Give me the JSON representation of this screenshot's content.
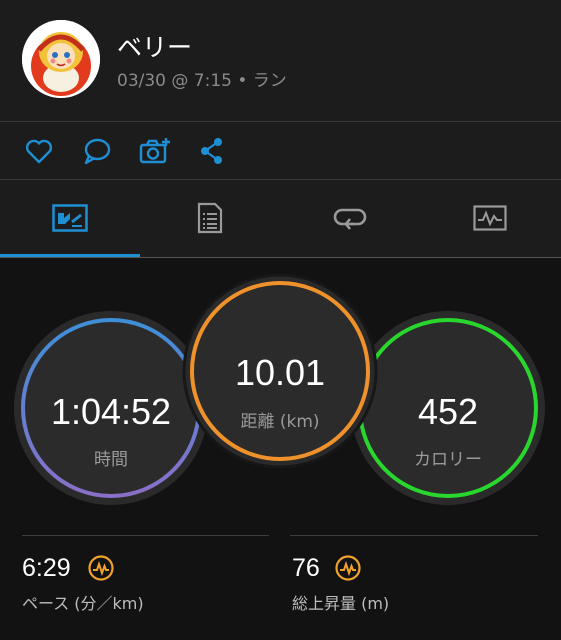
{
  "header": {
    "username": "ベリー",
    "subtitle": "03/30 @ 7:15 • ラン"
  },
  "actions": {
    "icons": [
      "heart-icon",
      "comment-icon",
      "add-photo-icon",
      "share-icon"
    ]
  },
  "tabs": {
    "icons": [
      "overview-icon",
      "details-icon",
      "laps-icon",
      "charts-icon"
    ],
    "active_index": 0
  },
  "metrics": {
    "time": {
      "value": "1:04:52",
      "label": "時間"
    },
    "distance": {
      "value": "10.01",
      "label": "距離 (km)"
    },
    "calories": {
      "value": "452",
      "label": "カロリー"
    }
  },
  "stats": {
    "pace": {
      "value": "6:29",
      "label": "ペース (分／km)",
      "icon": "pace-badge-icon"
    },
    "ascent": {
      "value": "76",
      "label": "総上昇量 (m)",
      "icon": "ascent-badge-icon"
    }
  },
  "colors": {
    "accent_blue": "#1f8fd4",
    "time_ring_top": "#3e8fd8",
    "time_ring_bottom": "#8a6fc8",
    "distance_ring": "#f0922b",
    "calories_ring": "#29d62e",
    "badge_orange": "#f0a22b"
  }
}
